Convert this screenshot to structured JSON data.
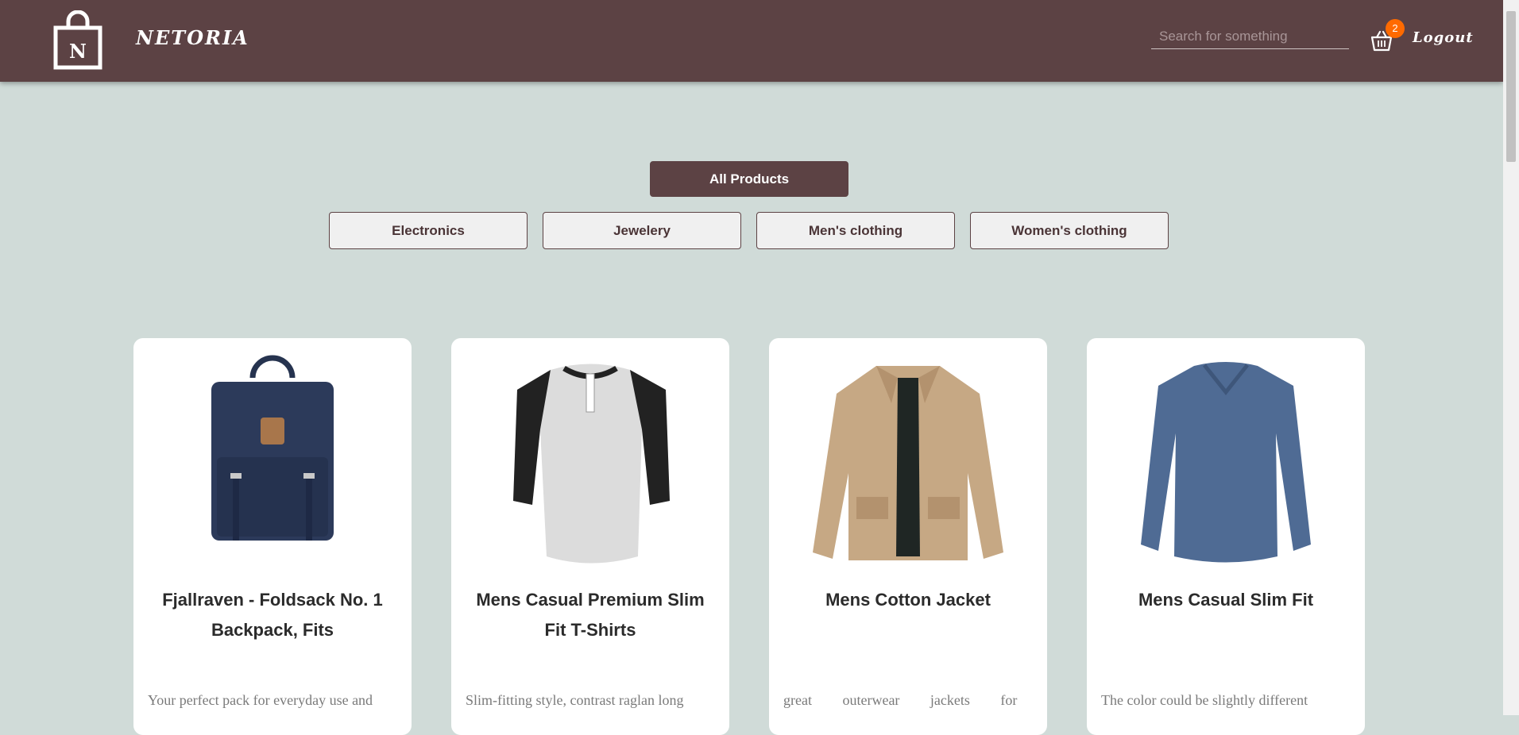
{
  "header": {
    "logo_letter": "N",
    "brand": "NETORIA",
    "search_placeholder": "Search for something",
    "cart_count": "2",
    "logout": "Logout"
  },
  "filters": {
    "all": "All Products",
    "categories": [
      "Electronics",
      "Jewelery",
      "Men's clothing",
      "Women's clothing"
    ]
  },
  "products": [
    {
      "title": "Fjallraven - Foldsack No. 1 Backpack, Fits",
      "description": "Your perfect pack for everyday use and",
      "icon": "backpack-image"
    },
    {
      "title": "Mens Casual Premium Slim Fit T-Shirts",
      "description": "Slim-fitting style, contrast raglan long",
      "icon": "raglan-tshirt-image"
    },
    {
      "title": "Mens Cotton Jacket",
      "description": "great outerwear jackets for",
      "icon": "cotton-jacket-image"
    },
    {
      "title": "Mens Casual Slim Fit",
      "description": "The color could be slightly different",
      "icon": "longsleeve-shirt-image"
    }
  ],
  "colors": {
    "header_bg": "#5c4244",
    "page_bg": "#d0dbd8",
    "badge": "#ff6a00"
  }
}
